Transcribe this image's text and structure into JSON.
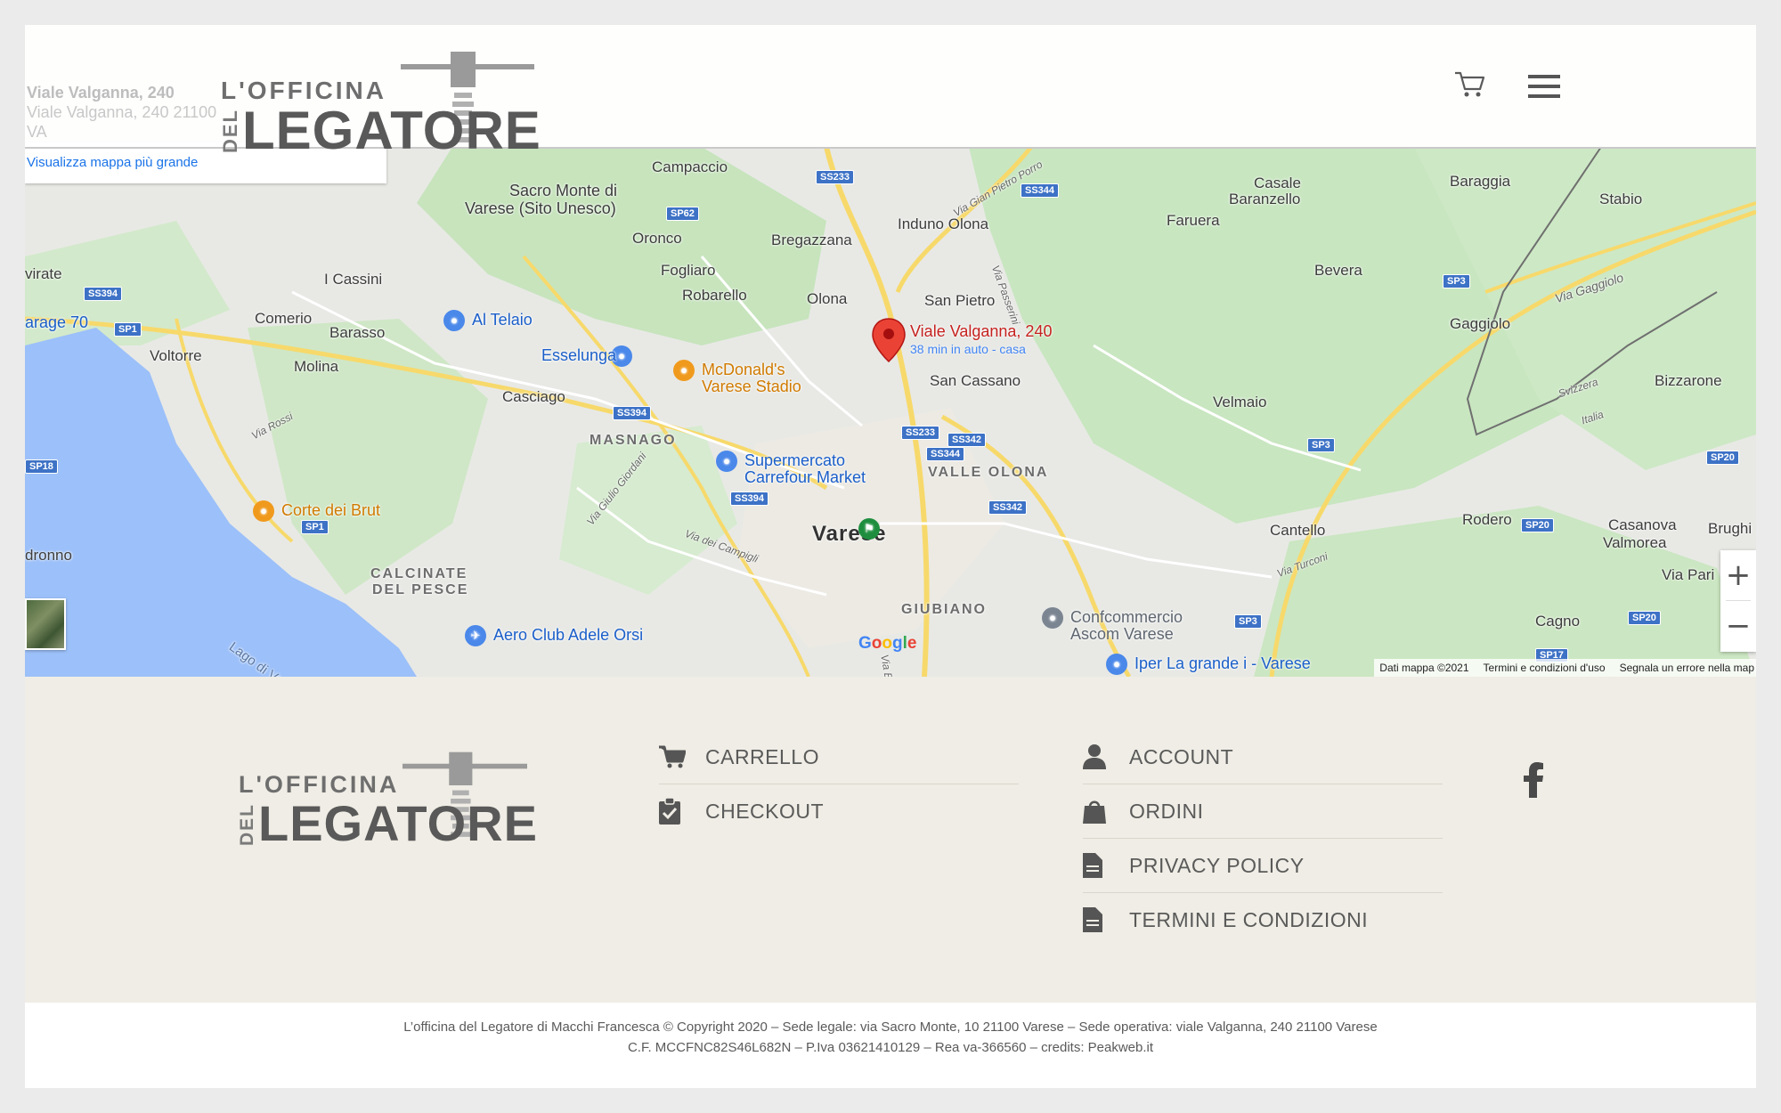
{
  "header": {
    "faded_address_title": "Viale Valganna, 240",
    "faded_address_line": "Viale Valganna, 240 21100",
    "faded_address_line2": "VA",
    "logo": {
      "line1": "L'OFFICINA",
      "line2": "LEGATORE",
      "rotated": "DEL"
    },
    "cart_icon": "cart-icon",
    "menu_icon": "hamburger-menu-icon"
  },
  "map": {
    "view_larger_link": "Visualizza mappa più grande",
    "pin": {
      "title": "Viale Valganna, 240",
      "subtitle": "38 min in auto - casa"
    },
    "places": {
      "campaccio": "Campaccio",
      "sacro_monte": "Sacro Monte di",
      "sacro_monte2": "Varese (Sito Unesco)",
      "oronco": "Oronco",
      "bregazzana": "Bregazzana",
      "induno_olona": "Induno Olona",
      "casale": "Casale",
      "baranzello": "Baranzello",
      "baraggia": "Baraggia",
      "stabio": "Stabio",
      "faruera": "Faruera",
      "virate": "virate",
      "i_cassini": "I Cassini",
      "fogliaro": "Fogliaro",
      "robarello": "Robarello",
      "olona": "Olona",
      "san_pietro": "San Pietro",
      "bevera": "Bevera",
      "gaggiolo": "Gaggiolo",
      "arage70": "arage 70",
      "comerio": "Comerio",
      "barasso": "Barasso",
      "voltorre": "Voltorre",
      "molina": "Molina",
      "casciago": "Casciago",
      "san_cassano": "San Cassano",
      "velmaio": "Velmaio",
      "bizzarone": "Bizzarone",
      "masnago": "MASNAGO",
      "valle_olona": "VALLE OLONA",
      "varese": "Varese",
      "cantello": "Cantello",
      "rodero": "Rodero",
      "casanova": "Casanova",
      "valmorea": "Valmorea",
      "brughi": "Brughi",
      "dronno": "dronno",
      "calcinate": "CALCINATE",
      "del_pesce": "DEL PESCE",
      "giubiano": "GIUBIANO",
      "via_pari": "Via Pari",
      "cagno": "Cagno",
      "lago": "Lago di Vare",
      "svizzera": "Svizzera",
      "italia": "Italia"
    },
    "roads": {
      "via_gian_pietro": "Via Gian Pietro Porro",
      "via_passerini": "Via Passerini",
      "via_gaggiolo": "Via Gaggiolo",
      "via_rossi": "Via Rossi",
      "via_giulio": "Via Giulio Giordani",
      "via_campigli": "Via dei Campigli",
      "via_turconi": "Via Turconi",
      "via_europa": "Via Europa"
    },
    "shields": {
      "ss233a": "SS233",
      "ss344a": "SS344",
      "sp62": "SP62",
      "ss394a": "SS394",
      "sp1a": "SP1",
      "ss394b": "SS394",
      "ss233b": "SS233",
      "ss342a": "SS342",
      "ss344b": "SS344",
      "sp18": "SP18",
      "ss394c": "SS394",
      "ss342b": "SS342",
      "sp1b": "SP1",
      "sp3a": "SP3",
      "sp3b": "SP3",
      "sp20a": "SP20",
      "sp20b": "SP20",
      "sp20c": "SP20",
      "sp3c": "SP3",
      "sp17": "SP17"
    },
    "pois": {
      "al_telaio": "Al Telaio",
      "esselunga": "Esselunga",
      "mcdonalds": "McDonald's",
      "mcdonalds2": "Varese Stadio",
      "supermercato": "Supermercato",
      "supermercato2": "Carrefour Market",
      "corte_brut": "Corte dei Brut",
      "aero_club": "Aero Club Adele Orsi",
      "confcommercio": "Confcommercio",
      "confcommercio2": "Ascom Varese",
      "iper": "Iper La grande i - Varese"
    },
    "zoom_in": "+",
    "zoom_out": "−",
    "google": [
      "G",
      "o",
      "o",
      "g",
      "l",
      "e"
    ],
    "attribution": {
      "data": "Dati mappa ©2021",
      "terms": "Termini e condizioni d'uso",
      "report": "Segnala un errore nella map"
    }
  },
  "footer": {
    "links_left": [
      {
        "icon": "cart-icon",
        "label": "CARRELLO"
      },
      {
        "icon": "clipboard-check-icon",
        "label": "CHECKOUT"
      }
    ],
    "links_right": [
      {
        "icon": "user-icon",
        "label": "ACCOUNT"
      },
      {
        "icon": "shopping-bag-icon",
        "label": "ORDINI"
      },
      {
        "icon": "document-icon",
        "label": "PRIVACY POLICY"
      },
      {
        "icon": "document-icon",
        "label": "TERMINI E CONDIZIONI"
      }
    ],
    "social_icon": "facebook-icon",
    "copyright_line1": "L’officina del Legatore di Macchi Francesca © Copyright 2020 – Sede legale: via Sacro Monte, 10 21100 Varese – Sede operativa: viale Valganna, 240 21100 Varese",
    "copyright_line2": "C.F. MCCFNC82S46L682N – P.Iva 03621410129 – Rea va-366560 – credits: Peakweb.it"
  },
  "colors": {
    "page_bg": "#ebebeb",
    "footer_bg": "#efede5",
    "footer_text": "#5a5a5a",
    "map_green": "#c8e6c0",
    "map_water": "#9cc0f9",
    "map_road": "#f7d96b",
    "pin_red": "#ea4335",
    "link_blue": "#1a73e8"
  }
}
